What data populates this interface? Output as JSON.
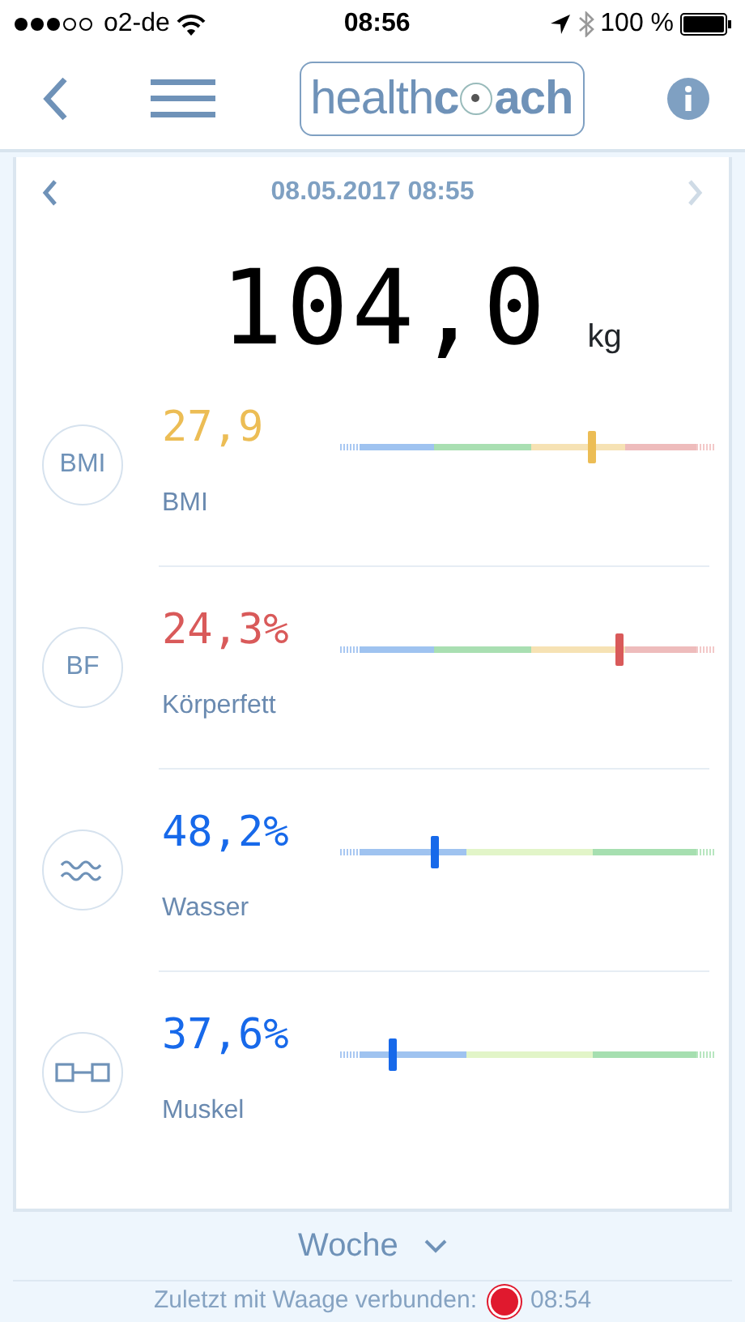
{
  "status_bar": {
    "carrier": "o2-de",
    "time": "08:56",
    "battery": "100 %"
  },
  "header": {
    "logo_light": "health",
    "logo_bold_1": "c",
    "logo_bold_2": "ach"
  },
  "date_nav": {
    "date": "08.05.2017 08:55",
    "next_disabled": true
  },
  "weight": {
    "value": "104,0",
    "unit": "kg"
  },
  "metrics": [
    {
      "kind": "text",
      "icon_text": "BMI",
      "value": "27,9",
      "label": "BMI",
      "color": "#ecbd55",
      "gauge": [
        {
          "color": "#a9c8f2"
        },
        {
          "color": "#9fc3f0"
        },
        {
          "color": "#a9dfb2"
        },
        {
          "color": "#f6e2b4"
        },
        {
          "color": "#eebcbc"
        },
        {
          "color": "#f3c9c9"
        }
      ],
      "level": 0.67
    },
    {
      "kind": "text",
      "icon_text": "BF",
      "value": "24,3%",
      "label": "Körperfett",
      "color": "#d95a5a",
      "gauge": [
        {
          "color": "#a9c8f2"
        },
        {
          "color": "#9fc3f0"
        },
        {
          "color": "#a9dfb2"
        },
        {
          "color": "#f6e2b4"
        },
        {
          "color": "#eebcbc"
        },
        {
          "color": "#f3c9c9"
        }
      ],
      "level": 0.74
    },
    {
      "kind": "wave",
      "value": "48,2%",
      "label": "Wasser",
      "color": "#1769ea",
      "gauge": [
        {
          "color": "#a9c8f2"
        },
        {
          "color": "#9fc3f0"
        },
        {
          "color": "#e2f5c8"
        },
        {
          "color": "#a6dfb0"
        },
        {
          "color": "#b8e6c0"
        }
      ],
      "level": 0.25
    },
    {
      "kind": "dumbbell",
      "value": "37,6%",
      "label": "Muskel",
      "color": "#1769ea",
      "gauge": [
        {
          "color": "#a9c8f2"
        },
        {
          "color": "#9fc3f0"
        },
        {
          "color": "#e2f5c8"
        },
        {
          "color": "#a6dfb0"
        },
        {
          "color": "#b8e6c0"
        }
      ],
      "level": 0.14
    }
  ],
  "footer": {
    "period": "Woche",
    "connection_label": "Zuletzt mit Waage verbunden:",
    "connected": false,
    "connection_time": "08:54"
  }
}
